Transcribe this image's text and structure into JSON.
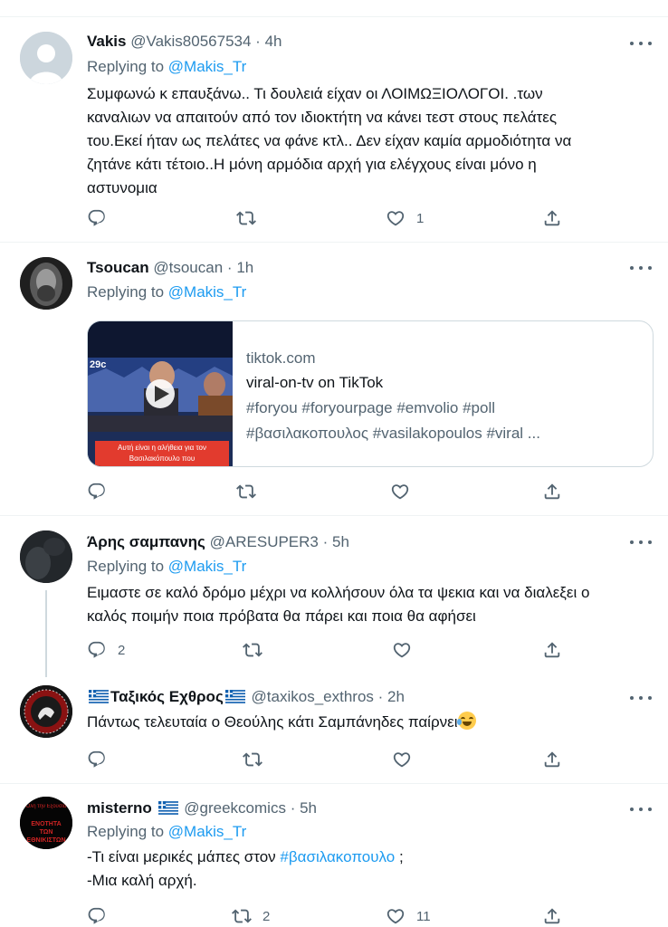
{
  "tweets": [
    {
      "name": "Vakis",
      "handle": "@Vakis80567534",
      "sep": "·",
      "time": "4h",
      "replying_prefix": "Replying to ",
      "replying_to": "@Makis_Tr",
      "lines": [
        "Συμφωνώ κ επαυξάνω.. Τι δουλειά είχαν οι ΛΟΙΜΩΞΙΟΛΟΓΟΙ.  .των",
        "καναλιων να απαιτούν από τον ιδιοκτήτη να κάνει τεστ στους πελάτες",
        "του.Εκεί ήταν ως πελάτες να φάνε κτλ.. Δεν είχαν καμία αρμοδιότητα να",
        "ζητάνε κάτι τέτοιο..Η μόνη αρμόδια αρχή για ελέγχους είναι μόνο η",
        "αστυνομια"
      ],
      "reply_count": "",
      "retweet_count": "",
      "like_count": "1"
    },
    {
      "name": "Tsoucan",
      "handle": "@tsoucan",
      "sep": "·",
      "time": "1h",
      "replying_prefix": "Replying to ",
      "replying_to": "@Makis_Tr",
      "card": {
        "domain": "tiktok.com",
        "title": "viral-on-tv on TikTok",
        "desc_line1": "#foryou #foryourpage #emvolio #poll",
        "desc_line2": "#βασιλακοπουλος #vasilakopoulos #viral ...",
        "thumb_temp": "29c",
        "thumb_caption": "Αυτή είναι η αλήθεια για τον Βασιλακόπουλο που"
      },
      "reply_count": "",
      "retweet_count": "",
      "like_count": ""
    },
    {
      "name": "Άρης σαμπανης",
      "handle": "@ARESUPER3",
      "sep": "·",
      "time": "5h",
      "replying_prefix": "Replying to ",
      "replying_to": "@Makis_Tr",
      "lines": [
        "Ειμαστε σε καλό δρόμο μέχρι να κολλήσουν όλα τα ψεκια και να διαλεξει ο",
        "καλός ποιμήν ποια πρόβατα θα πάρει και ποια θα αφήσει"
      ],
      "reply_count": "2",
      "retweet_count": "",
      "like_count": ""
    },
    {
      "name": "Ταξικός Εχθρος",
      "handle": "@taxikos_exthros",
      "sep": "·",
      "time": "2h",
      "text": "Πάντως τελευταία ο Θεούλης κάτι Σαμπάνηδες παίρνει",
      "reply_count": "",
      "retweet_count": "",
      "like_count": ""
    },
    {
      "name": "misterno",
      "handle": "@greekcomics",
      "sep": "·",
      "time": "5h",
      "replying_prefix": "Replying to ",
      "replying_to": "@Makis_Tr",
      "line1_prefix": "-Τι είναι μερικές μάπες στον ",
      "line1_hashtag": "#βασιλακοπουλο",
      "line1_suffix": " ;",
      "line2": "-Μια καλή αρχή.",
      "avatar_text1": "Όλη την Εξουσία",
      "avatar_text2": "ΕΝΟΤΗΤΑ ΤΩΝ ΕΘΝΙΚΙΣΤΩΝ",
      "reply_count": "",
      "retweet_count": "2",
      "like_count": "11"
    }
  ],
  "colors": {
    "text": "#0f1419",
    "secondary": "#536471",
    "link": "#1d9bf0",
    "border": "#eff3f4"
  }
}
